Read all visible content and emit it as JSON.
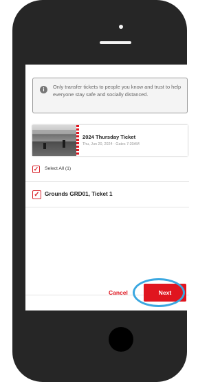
{
  "notice": {
    "text": "Only transfer tickets to people you know and trust to help everyone stay safe and socially distanced.",
    "icon": "info-icon"
  },
  "ticket": {
    "title": "2024 Thursday Ticket",
    "subtitle": "Thu, Jun 20, 2024 · Gates 7:30AM"
  },
  "select_all": {
    "label": "Select All (1)",
    "checked": true
  },
  "ticket_item": {
    "label": "Grounds GRD01, Ticket 1",
    "checked": true
  },
  "actions": {
    "cancel_label": "Cancel",
    "next_label": "Next"
  },
  "colors": {
    "accent": "#e0151f",
    "highlight": "#3aa7e0",
    "phone": "#262626"
  }
}
